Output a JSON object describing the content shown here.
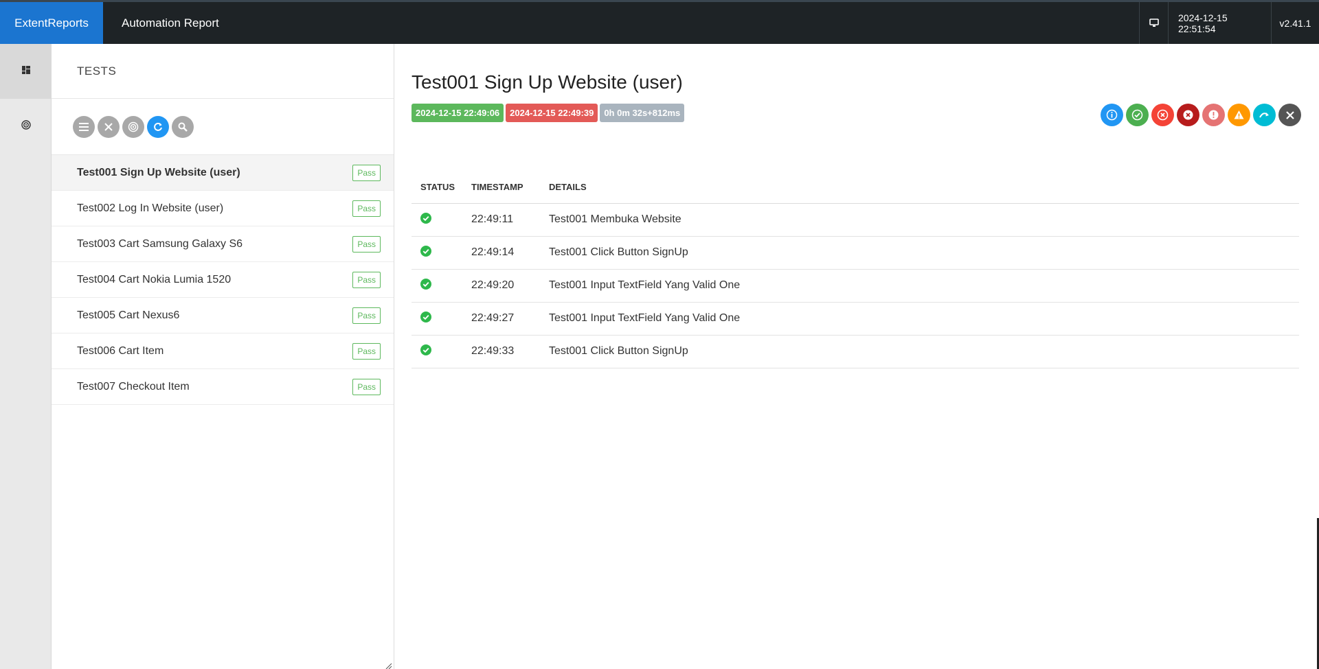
{
  "app": {
    "brand": "ExtentReports",
    "report_name": "Automation Report",
    "datetime": "2024-12-15 22:51:54",
    "version": "v2.41.1"
  },
  "nav": {
    "items": [
      {
        "icon": "dashboard-icon",
        "active": true
      },
      {
        "icon": "target-icon",
        "active": false
      }
    ]
  },
  "tests_panel": {
    "title": "TESTS",
    "toolbar_icons": [
      "list-icon",
      "close-icon",
      "target-icon",
      "refresh-icon",
      "search-icon"
    ],
    "tests": [
      {
        "name": "Test001 Sign Up Website (user)",
        "status": "Pass"
      },
      {
        "name": "Test002 Log In Website (user)",
        "status": "Pass"
      },
      {
        "name": "Test003 Cart Samsung Galaxy S6",
        "status": "Pass"
      },
      {
        "name": "Test004 Cart Nokia Lumia 1520",
        "status": "Pass"
      },
      {
        "name": "Test005 Cart Nexus6",
        "status": "Pass"
      },
      {
        "name": "Test006 Cart Item",
        "status": "Pass"
      },
      {
        "name": "Test007 Checkout Item",
        "status": "Pass"
      }
    ]
  },
  "detail": {
    "title": "Test001 Sign Up Website (user)",
    "start_time": "2024-12-15 22:49:06",
    "end_time": "2024-12-15 22:49:39",
    "duration": "0h 0m 32s+812ms",
    "status_filters": [
      {
        "name": "info-filter-icon",
        "color": "#2196f3",
        "glyph": "i"
      },
      {
        "name": "pass-filter-icon",
        "color": "#4caf50",
        "glyph": "check"
      },
      {
        "name": "fail-filter-icon",
        "color": "#f44336",
        "glyph": "x"
      },
      {
        "name": "fatal-filter-icon",
        "color": "#b71c1c",
        "glyph": "x"
      },
      {
        "name": "error-filter-icon",
        "color": "#e57373",
        "glyph": "!"
      },
      {
        "name": "warning-filter-icon",
        "color": "#ff9800",
        "glyph": "!"
      },
      {
        "name": "skip-filter-icon",
        "color": "#00bcd4",
        "glyph": "arrow"
      },
      {
        "name": "clear-filter-icon",
        "color": "#555555",
        "glyph": "close"
      }
    ],
    "columns": [
      "STATUS",
      "TIMESTAMP",
      "DETAILS"
    ],
    "logs": [
      {
        "status": "pass",
        "timestamp": "22:49:11",
        "details": "Test001 Membuka Website"
      },
      {
        "status": "pass",
        "timestamp": "22:49:14",
        "details": "Test001 Click Button SignUp"
      },
      {
        "status": "pass",
        "timestamp": "22:49:20",
        "details": "Test001 Input TextField Yang Valid One"
      },
      {
        "status": "pass",
        "timestamp": "22:49:27",
        "details": "Test001 Input TextField Yang Valid One"
      },
      {
        "status": "pass",
        "timestamp": "22:49:33",
        "details": "Test001 Click Button SignUp"
      }
    ]
  },
  "colors": {
    "brand": "#1b75d0",
    "topbar": "#1e2326",
    "pass": "#5cb85c",
    "fail": "#e35a57"
  }
}
